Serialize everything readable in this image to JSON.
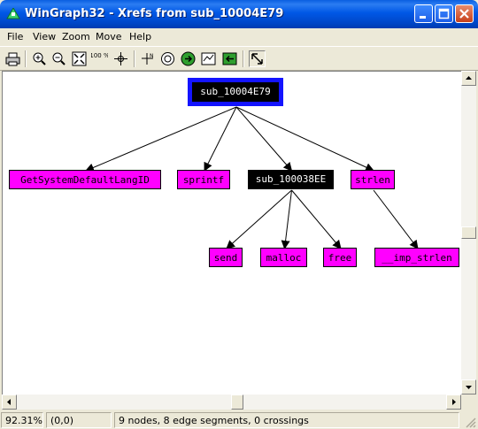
{
  "window": {
    "title": "WinGraph32 - Xrefs from sub_10004E79"
  },
  "menu": [
    "File",
    "View",
    "Zoom",
    "Move",
    "Help"
  ],
  "toolbar": [
    {
      "name": "print-icon"
    },
    {
      "name": "zoom-in-icon"
    },
    {
      "name": "zoom-out-icon"
    },
    {
      "name": "fit-window-icon"
    },
    {
      "name": "zoom-100-icon",
      "label": "100 %"
    },
    {
      "name": "center-icon"
    },
    {
      "name": "origin-icon"
    },
    {
      "name": "radar-icon"
    },
    {
      "name": "go-icon"
    },
    {
      "name": "layout-icon"
    },
    {
      "name": "go-back-icon"
    },
    {
      "name": "pointer-arrow-icon"
    }
  ],
  "graph": {
    "nodes": [
      {
        "id": "n-root",
        "label": "sub_10004E79",
        "style": "root"
      },
      {
        "id": "n-getlang",
        "label": "GetSystemDefaultLangID",
        "style": "magenta"
      },
      {
        "id": "n-sprintf",
        "label": "sprintf",
        "style": "magenta"
      },
      {
        "id": "n-sub2",
        "label": "sub_100038EE",
        "style": "black"
      },
      {
        "id": "n-strlen",
        "label": "strlen",
        "style": "magenta"
      },
      {
        "id": "n-send",
        "label": "send",
        "style": "magenta"
      },
      {
        "id": "n-malloc",
        "label": "malloc",
        "style": "magenta"
      },
      {
        "id": "n-free",
        "label": "free",
        "style": "magenta"
      },
      {
        "id": "n-imp-strlen",
        "label": "__imp_strlen",
        "style": "magenta"
      }
    ],
    "edges": [
      [
        "n-root",
        "n-getlang"
      ],
      [
        "n-root",
        "n-sprintf"
      ],
      [
        "n-root",
        "n-sub2"
      ],
      [
        "n-root",
        "n-strlen"
      ],
      [
        "n-sub2",
        "n-send"
      ],
      [
        "n-sub2",
        "n-malloc"
      ],
      [
        "n-sub2",
        "n-free"
      ],
      [
        "n-strlen",
        "n-imp-strlen"
      ]
    ]
  },
  "status": {
    "zoom": "92.31%",
    "coords": "(0,0)",
    "info": "9 nodes, 8 edge segments, 0 crossings"
  },
  "colors": {
    "node": "#ff00ff",
    "root_frame": "#1414ff",
    "titlebar": "#0054e3"
  }
}
